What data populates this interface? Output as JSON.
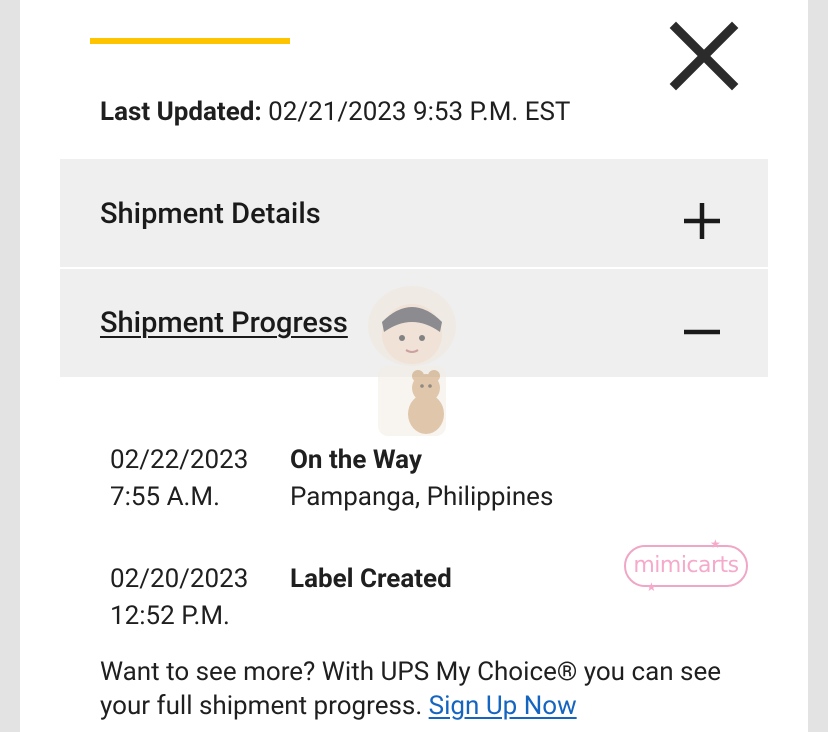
{
  "colors": {
    "accent": "#ffc400",
    "page_bg": "#e3e3e3",
    "panel_bg": "#efefef",
    "link": "#1565c0"
  },
  "header": {
    "close_icon": "close-x-icon",
    "last_updated_label": "Last Updated:",
    "last_updated_value": "02/21/2023 9:53 P.M. EST"
  },
  "accordion": [
    {
      "title": "Shipment Details",
      "icon": "plus-icon",
      "expanded": false
    },
    {
      "title": "Shipment Progress",
      "icon": "minus-icon",
      "expanded": true
    }
  ],
  "events": [
    {
      "date": "02/22/2023",
      "time": "7:55 A.M.",
      "status": "On the Way",
      "location": "Pampanga, Philippines"
    },
    {
      "date": "02/20/2023",
      "time": "12:52 P.M.",
      "status": "Label Created",
      "location": ""
    }
  ],
  "watermark": {
    "text": "mimicarts"
  },
  "footer": {
    "text": "Want to see more? With UPS My Choice® you can see your full shipment progress.",
    "link_label": "Sign Up Now"
  }
}
